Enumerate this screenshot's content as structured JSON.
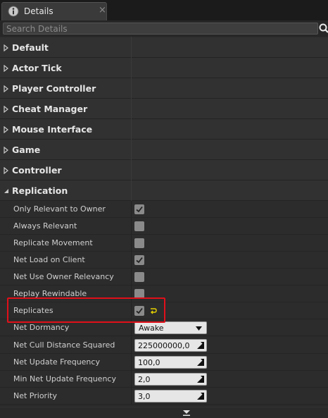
{
  "tab": {
    "label": "Details",
    "icon": "details-icon",
    "close": "×"
  },
  "search": {
    "placeholder": "Search Details",
    "value": ""
  },
  "categories": [
    {
      "label": "Default",
      "expanded": false
    },
    {
      "label": "Actor Tick",
      "expanded": false
    },
    {
      "label": "Player Controller",
      "expanded": false
    },
    {
      "label": "Cheat Manager",
      "expanded": false
    },
    {
      "label": "Mouse Interface",
      "expanded": false
    },
    {
      "label": "Game",
      "expanded": false
    },
    {
      "label": "Controller",
      "expanded": false
    },
    {
      "label": "Replication",
      "expanded": true
    }
  ],
  "replication": {
    "only_relevant_to_owner": {
      "label": "Only Relevant to Owner",
      "checked": true
    },
    "always_relevant": {
      "label": "Always Relevant",
      "checked": false
    },
    "replicate_movement": {
      "label": "Replicate Movement",
      "checked": false
    },
    "net_load_on_client": {
      "label": "Net Load on Client",
      "checked": true
    },
    "net_use_owner_relevancy": {
      "label": "Net Use Owner Relevancy",
      "checked": false
    },
    "replay_rewindable": {
      "label": "Replay Rewindable",
      "checked": false
    },
    "replicates": {
      "label": "Replicates",
      "checked": true,
      "reset_icon": "reset-to-default-icon"
    },
    "net_dormancy": {
      "label": "Net Dormancy",
      "value": "Awake"
    },
    "net_cull_distance_squared": {
      "label": "Net Cull Distance Squared",
      "value": "225000000,0"
    },
    "net_update_frequency": {
      "label": "Net Update Frequency",
      "value": "100,0"
    },
    "min_net_update_frequency": {
      "label": "Min Net Update Frequency",
      "value": "2,0"
    },
    "net_priority": {
      "label": "Net Priority",
      "value": "3,0"
    }
  },
  "colors": {
    "highlight": "#e0101a",
    "reset_arrow": "#e6d200",
    "panel_bg": "#2a2a2a"
  }
}
